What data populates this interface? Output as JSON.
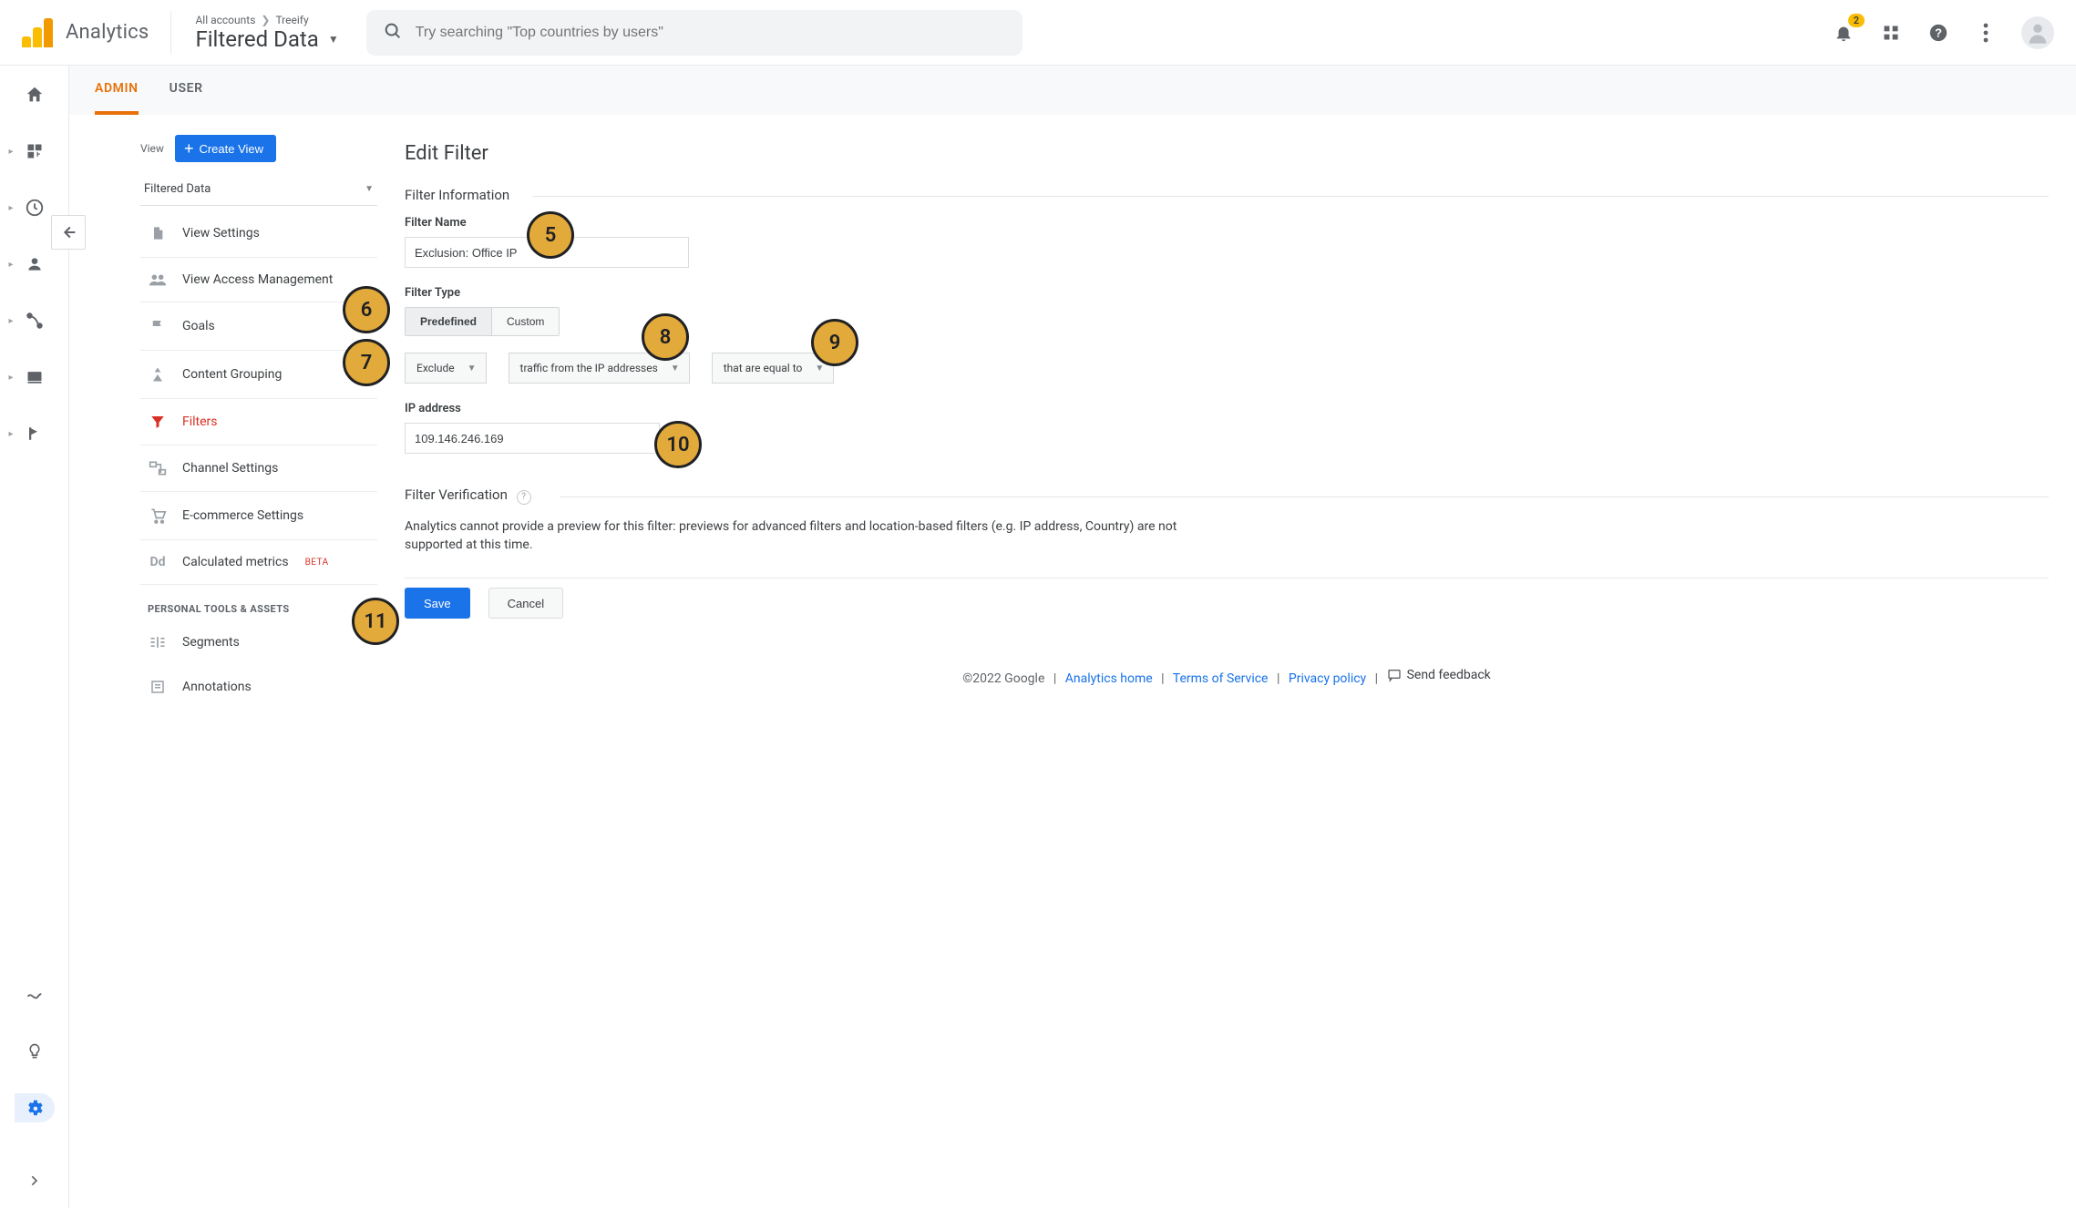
{
  "header": {
    "product_name": "Analytics",
    "breadcrumbs": {
      "root": "All accounts",
      "property": "Treeify"
    },
    "view_title": "Filtered Data",
    "search_placeholder": "Try searching \"Top countries by users\"",
    "notification_count": "2"
  },
  "tabs": {
    "admin": "ADMIN",
    "user": "USER"
  },
  "sidebar": {
    "view_section_label": "View",
    "create_view_label": "Create View",
    "view_picker_value": "Filtered Data",
    "nav": [
      {
        "icon": "page",
        "label": "View Settings"
      },
      {
        "icon": "people",
        "label": "View Access Management"
      },
      {
        "icon": "flag",
        "label": "Goals"
      },
      {
        "icon": "grouping",
        "label": "Content Grouping"
      },
      {
        "icon": "funnel",
        "label": "Filters",
        "active": true
      },
      {
        "icon": "channel",
        "label": "Channel Settings"
      },
      {
        "icon": "cart",
        "label": "E-commerce Settings"
      },
      {
        "icon": "dd",
        "label": "Calculated metrics",
        "beta": "BETA"
      }
    ],
    "personal_header": "PERSONAL TOOLS & ASSETS",
    "personal": [
      {
        "icon": "segments",
        "label": "Segments"
      },
      {
        "icon": "note",
        "label": "Annotations"
      }
    ]
  },
  "form": {
    "page_title": "Edit Filter",
    "section_info": "Filter Information",
    "filter_name_label": "Filter Name",
    "filter_name_value": "Exclusion: Office IP",
    "filter_type_label": "Filter Type",
    "type_predefined": "Predefined",
    "type_custom": "Custom",
    "dd_action": "Exclude",
    "dd_source": "traffic from the IP addresses",
    "dd_condition": "that are equal to",
    "ip_label": "IP address",
    "ip_value": "109.146.246.169",
    "section_verify": "Filter Verification",
    "verify_msg": "Analytics cannot provide a preview for this filter: previews for advanced filters and location-based filters (e.g. IP address, Country) are not supported at this time.",
    "save": "Save",
    "cancel": "Cancel"
  },
  "markers": {
    "5": "5",
    "6": "6",
    "7": "7",
    "8": "8",
    "9": "9",
    "10": "10",
    "11": "11"
  },
  "footer": {
    "copyright": "©2022 Google",
    "analytics_home": "Analytics home",
    "tos": "Terms of Service",
    "privacy": "Privacy policy",
    "feedback": "Send feedback"
  }
}
